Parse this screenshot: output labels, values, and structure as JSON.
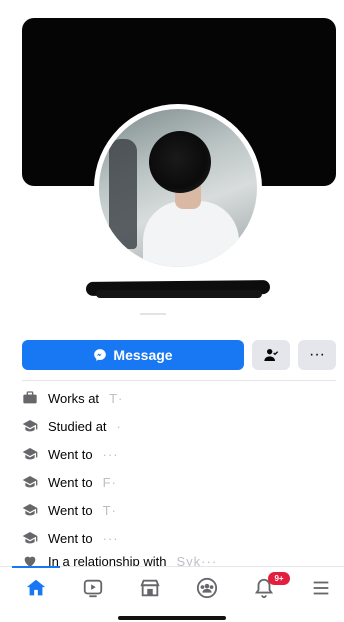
{
  "profile": {
    "name_redacted": true
  },
  "actions": {
    "message_label": "Message",
    "friend_icon": "person-check-icon",
    "more_label": "···"
  },
  "details": [
    {
      "icon": "briefcase-icon",
      "prefix": "Works at",
      "obscured": "T·"
    },
    {
      "icon": "graduation-cap-icon",
      "prefix": "Studied at",
      "obscured": "·"
    },
    {
      "icon": "graduation-cap-icon",
      "prefix": "Went to",
      "obscured": "···"
    },
    {
      "icon": "graduation-cap-icon",
      "prefix": "Went to",
      "obscured": "F·"
    },
    {
      "icon": "graduation-cap-icon",
      "prefix": "Went to",
      "obscured": "T·"
    },
    {
      "icon": "graduation-cap-icon",
      "prefix": "Went to",
      "obscured": "···"
    },
    {
      "icon": "heart-icon",
      "prefix": "In a relationship with",
      "obscured": "Syk···"
    }
  ],
  "tabbar": {
    "tabs": [
      "home-icon",
      "video-icon",
      "marketplace-icon",
      "groups-icon",
      "notifications-icon",
      "menu-icon"
    ],
    "active": "home-icon",
    "notification_badge": "9+"
  },
  "colors": {
    "accent": "#1877f2",
    "badge": "#e41e3f",
    "cover": "#050505",
    "button_secondary": "#e4e6eb"
  }
}
